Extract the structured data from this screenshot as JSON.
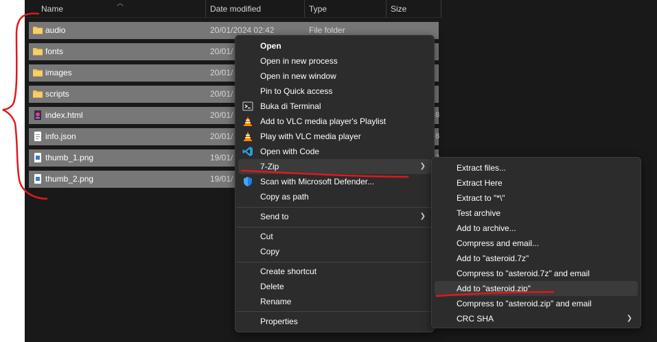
{
  "columns": {
    "name": "Name",
    "date": "Date modified",
    "type": "Type",
    "size": "Size"
  },
  "files": [
    {
      "name": "audio",
      "date": "20/01/2024 02:42",
      "type": "File folder",
      "size": "",
      "icon": "folder-icon"
    },
    {
      "name": "fonts",
      "date": "20/01/",
      "type": "",
      "size": "",
      "icon": "folder-icon"
    },
    {
      "name": "images",
      "date": "20/01/",
      "type": "",
      "size": "",
      "icon": "folder-icon"
    },
    {
      "name": "scripts",
      "date": "20/01/",
      "type": "",
      "size": "",
      "icon": "folder-icon"
    },
    {
      "name": "index.html",
      "date": "20/01/",
      "type": "",
      "size": "8",
      "icon": "html-file-icon"
    },
    {
      "name": "info.json",
      "date": "20/01/",
      "type": "",
      "size": "8",
      "icon": "json-file-icon"
    },
    {
      "name": "thumb_1.png",
      "date": "19/01/",
      "type": "",
      "size": "3",
      "icon": "image-file-icon"
    },
    {
      "name": "thumb_2.png",
      "date": "19/01/",
      "type": "",
      "size": "",
      "icon": "image-file-icon"
    }
  ],
  "context_menu": {
    "open": "Open",
    "open_new_process": "Open in new process",
    "open_new_window": "Open in new window",
    "pin_quick_access": "Pin to Quick access",
    "terminal": "Buka di Terminal",
    "vlc_playlist": "Add to VLC media player's Playlist",
    "vlc_play": "Play with VLC media player",
    "open_code": "Open with Code",
    "seven_zip": "7-Zip",
    "defender": "Scan with Microsoft Defender...",
    "copy_path": "Copy as path",
    "send_to": "Send to",
    "cut": "Cut",
    "copy": "Copy",
    "create_shortcut": "Create shortcut",
    "delete": "Delete",
    "rename": "Rename",
    "properties": "Properties"
  },
  "submenu_7zip": {
    "extract_files": "Extract files...",
    "extract_here": "Extract Here",
    "extract_to": "Extract to \"*\\\"",
    "test_archive": "Test archive",
    "add_to_archive": "Add to archive...",
    "compress_email": "Compress and email...",
    "add_7z": "Add to \"asteroid.7z\"",
    "compress_7z_email": "Compress to \"asteroid.7z\" and email",
    "add_zip": "Add to \"asteroid.zip\"",
    "compress_zip_email": "Compress to \"asteroid.zip\" and email",
    "crc_sha": "CRC SHA"
  },
  "colors": {
    "background": "#191919",
    "selection": "#777777",
    "menu": "#2c2c2c",
    "menu_highlight": "#3b3b3b",
    "annotation": "#e0191c",
    "folder": "#f2c14e",
    "vlc": "#f08a00",
    "vscode": "#2a9be0",
    "defender": "#1f7fe0"
  }
}
